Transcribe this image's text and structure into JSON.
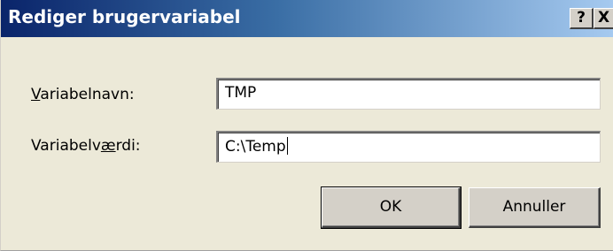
{
  "window": {
    "title": "Rediger brugervariabel",
    "help_label": "?",
    "close_label": "X"
  },
  "form": {
    "name_label_accel": "V",
    "name_label_rest": "ariabelnavn:",
    "name_value": "TMP",
    "value_label_pre": "Variabelv",
    "value_label_accel": "æ",
    "value_label_post": "rdi:",
    "value_value": "C:\\Temp"
  },
  "buttons": {
    "ok_label": "OK",
    "cancel_label": "Annuller"
  },
  "colors": {
    "titlebar_start": "#0a246a",
    "titlebar_end": "#a6caf0",
    "dialog_bg": "#ece9d8"
  },
  "icons": {
    "help": "question-mark-icon",
    "close": "close-icon"
  }
}
